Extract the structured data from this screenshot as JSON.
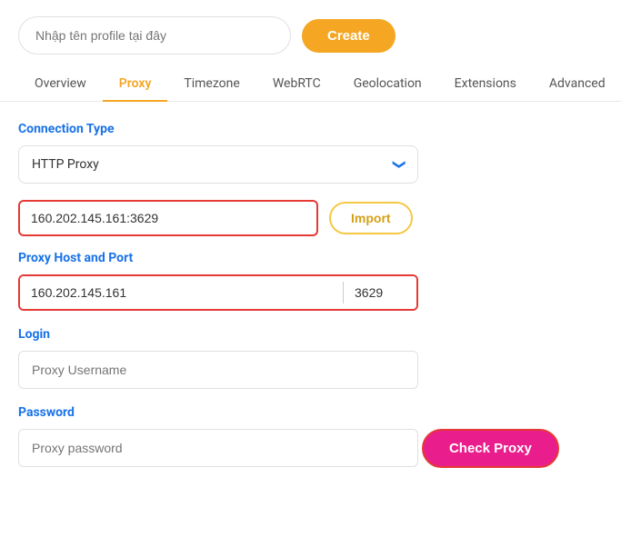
{
  "topBar": {
    "profileInputPlaceholder": "Nhập tên profile tại đây",
    "createButtonLabel": "Create"
  },
  "tabs": [
    {
      "id": "overview",
      "label": "Overview",
      "active": false
    },
    {
      "id": "proxy",
      "label": "Proxy",
      "active": true
    },
    {
      "id": "timezone",
      "label": "Timezone",
      "active": false
    },
    {
      "id": "webrtc",
      "label": "WebRTC",
      "active": false
    },
    {
      "id": "geolocation",
      "label": "Geolocation",
      "active": false
    },
    {
      "id": "extensions",
      "label": "Extensions",
      "active": false
    },
    {
      "id": "advanced",
      "label": "Advanced",
      "active": false
    }
  ],
  "connectionType": {
    "label": "Connection Type",
    "value": "HTTP Proxy"
  },
  "proxyImport": {
    "inputValue": "160.202.145.161:3629",
    "importButtonLabel": "Import"
  },
  "hostPort": {
    "label": "Proxy Host and Port",
    "hostValue": "160.202.145.161",
    "portValue": "3629"
  },
  "login": {
    "label": "Login",
    "placeholder": "Proxy Username"
  },
  "password": {
    "label": "Password",
    "placeholder": "Proxy password"
  },
  "checkProxyButton": {
    "label": "Check Proxy"
  },
  "icons": {
    "chevronDown": "❯"
  }
}
